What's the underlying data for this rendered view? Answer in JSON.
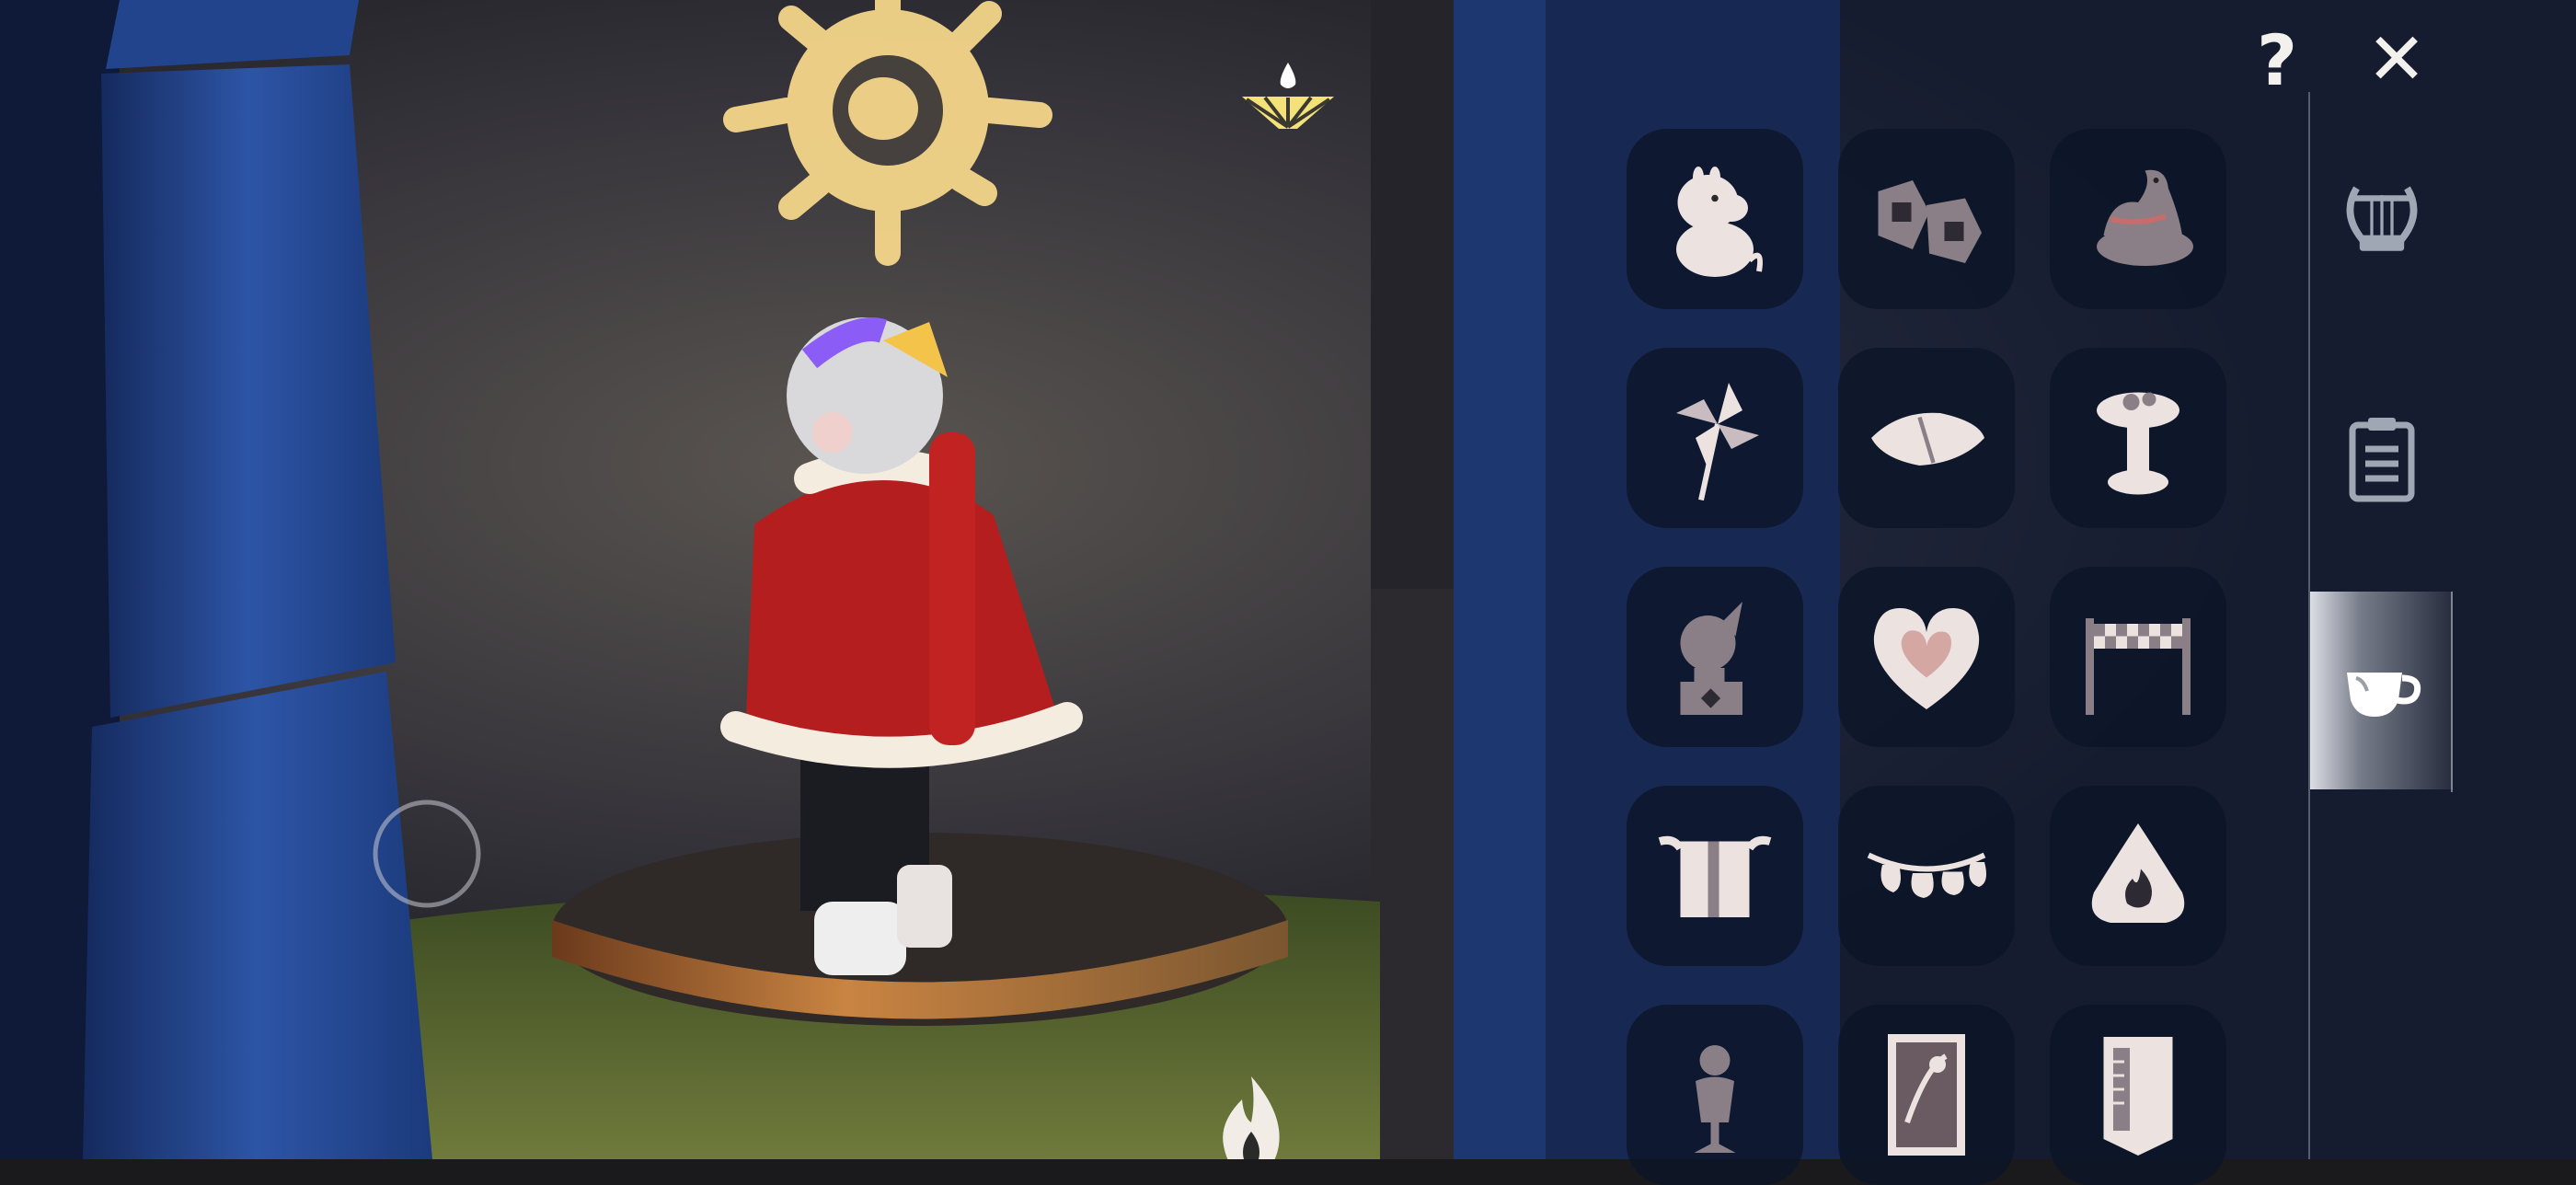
{
  "topbar": {
    "help_label": "?",
    "close_label": "✕"
  },
  "hud": {
    "sun_glyph": "sun-emblem",
    "fan_glyph": "wing-light-fan-icon",
    "joystick": "joystick-ring",
    "flame_glyph": "flame-icon"
  },
  "panel": {
    "items": [
      {
        "name": "moomin-icon"
      },
      {
        "name": "rock-pair-icon"
      },
      {
        "name": "bird-nest-icon"
      },
      {
        "name": "pinwheel-icon"
      },
      {
        "name": "cushion-icon"
      },
      {
        "name": "flower-pedestal-icon"
      },
      {
        "name": "music-box-icon"
      },
      {
        "name": "heart-icon"
      },
      {
        "name": "checkered-gate-icon"
      },
      {
        "name": "towel-rack-icon"
      },
      {
        "name": "bell-garland-icon"
      },
      {
        "name": "flame-badge-icon"
      },
      {
        "name": "mannequin-icon"
      },
      {
        "name": "framed-picture-icon"
      },
      {
        "name": "banner-icon"
      }
    ],
    "tabs": [
      {
        "name": "lyre-tab-icon",
        "active": false
      },
      {
        "name": "clipboard-tab-icon",
        "active": false
      },
      {
        "name": "teacup-tab-icon",
        "active": true
      }
    ],
    "icon_color": "#ece3e1",
    "icon_shade": "#8a7f86"
  },
  "colors": {
    "sun": "#f5d68a",
    "fan": "#f3e27a",
    "panel_bg": "#12203a",
    "tile_bg": "#0c1428",
    "pillar": "#2a4a8f"
  }
}
